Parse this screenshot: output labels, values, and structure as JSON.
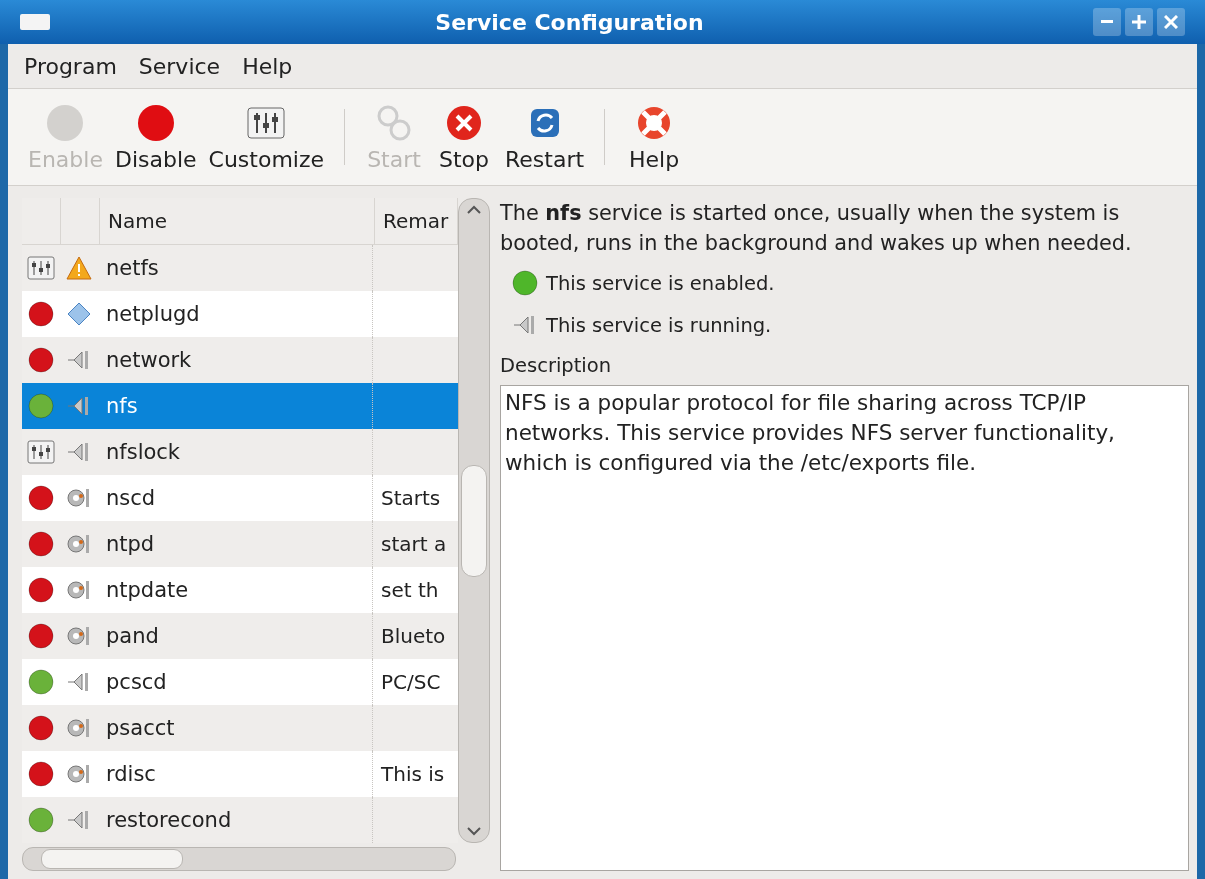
{
  "window": {
    "title": "Service Configuration"
  },
  "menu": [
    "Program",
    "Service",
    "Help"
  ],
  "toolbar": [
    {
      "label": "Enable",
      "kind": "enable",
      "disabled": true,
      "separator_before": false
    },
    {
      "label": "Disable",
      "kind": "disable",
      "disabled": false,
      "separator_before": false
    },
    {
      "label": "Customize",
      "kind": "customize",
      "disabled": false,
      "separator_before": false
    },
    {
      "label": "Start",
      "kind": "start",
      "disabled": true,
      "separator_before": true
    },
    {
      "label": "Stop",
      "kind": "stop",
      "disabled": false,
      "separator_before": false
    },
    {
      "label": "Restart",
      "kind": "restart",
      "disabled": false,
      "separator_before": false
    },
    {
      "label": "Help",
      "kind": "help",
      "disabled": false,
      "separator_before": true
    }
  ],
  "table": {
    "columns": [
      "Name",
      "Remar"
    ],
    "rows": [
      {
        "enable_icon": {
          "kind": "custom"
        },
        "status_icon": {
          "kind": "warning"
        },
        "name": "netfs",
        "remarks": "",
        "selected": false
      },
      {
        "enable_icon": {
          "kind": "disabled"
        },
        "status_icon": {
          "kind": "unknown"
        },
        "name": "netplugd",
        "remarks": "",
        "selected": false
      },
      {
        "enable_icon": {
          "kind": "disabled"
        },
        "status_icon": {
          "kind": "running"
        },
        "name": "network",
        "remarks": "",
        "selected": false
      },
      {
        "enable_icon": {
          "kind": "enabled"
        },
        "status_icon": {
          "kind": "running"
        },
        "name": "nfs",
        "remarks": "",
        "selected": true
      },
      {
        "enable_icon": {
          "kind": "custom"
        },
        "status_icon": {
          "kind": "running"
        },
        "name": "nfslock",
        "remarks": "",
        "selected": false
      },
      {
        "enable_icon": {
          "kind": "disabled"
        },
        "status_icon": {
          "kind": "stopped"
        },
        "name": "nscd",
        "remarks": "Starts",
        "selected": false
      },
      {
        "enable_icon": {
          "kind": "disabled"
        },
        "status_icon": {
          "kind": "stopped"
        },
        "name": "ntpd",
        "remarks": "start a",
        "selected": false
      },
      {
        "enable_icon": {
          "kind": "disabled"
        },
        "status_icon": {
          "kind": "stopped"
        },
        "name": "ntpdate",
        "remarks": "set th",
        "selected": false
      },
      {
        "enable_icon": {
          "kind": "disabled"
        },
        "status_icon": {
          "kind": "stopped"
        },
        "name": "pand",
        "remarks": "Blueto",
        "selected": false
      },
      {
        "enable_icon": {
          "kind": "enabled"
        },
        "status_icon": {
          "kind": "running"
        },
        "name": "pcscd",
        "remarks": "PC/SC",
        "selected": false
      },
      {
        "enable_icon": {
          "kind": "disabled"
        },
        "status_icon": {
          "kind": "stopped"
        },
        "name": "psacct",
        "remarks": "",
        "selected": false
      },
      {
        "enable_icon": {
          "kind": "disabled"
        },
        "status_icon": {
          "kind": "stopped"
        },
        "name": "rdisc",
        "remarks": "This is",
        "selected": false
      },
      {
        "enable_icon": {
          "kind": "enabled"
        },
        "status_icon": {
          "kind": "running"
        },
        "name": "restorecond",
        "remarks": "",
        "selected": false
      }
    ]
  },
  "details": {
    "summary": "The **nfs** service is started once, usually when the system is booted, runs in the background and wakes up when needed.",
    "states": [
      {
        "kind": "enabled",
        "text": "This service is enabled."
      },
      {
        "kind": "running",
        "text": "This service is running."
      }
    ],
    "description_label": "Description",
    "description": "NFS is a popular protocol for file sharing across TCP/IP networks. This service provides NFS server functionality, which is configured via the /etc/exports file."
  }
}
